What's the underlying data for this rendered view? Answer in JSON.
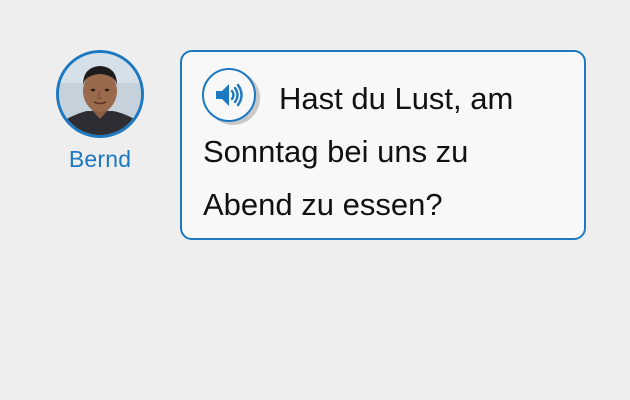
{
  "speaker": {
    "name": "Bernd"
  },
  "message": {
    "text": "Hast du Lust, am Sonntag bei uns zu Abend zu essen?"
  },
  "colors": {
    "accent": "#1c78c0",
    "background": "#eeeeee",
    "bubble": "#f8f8f8"
  },
  "icons": {
    "audio": "speaker-volume-icon"
  }
}
